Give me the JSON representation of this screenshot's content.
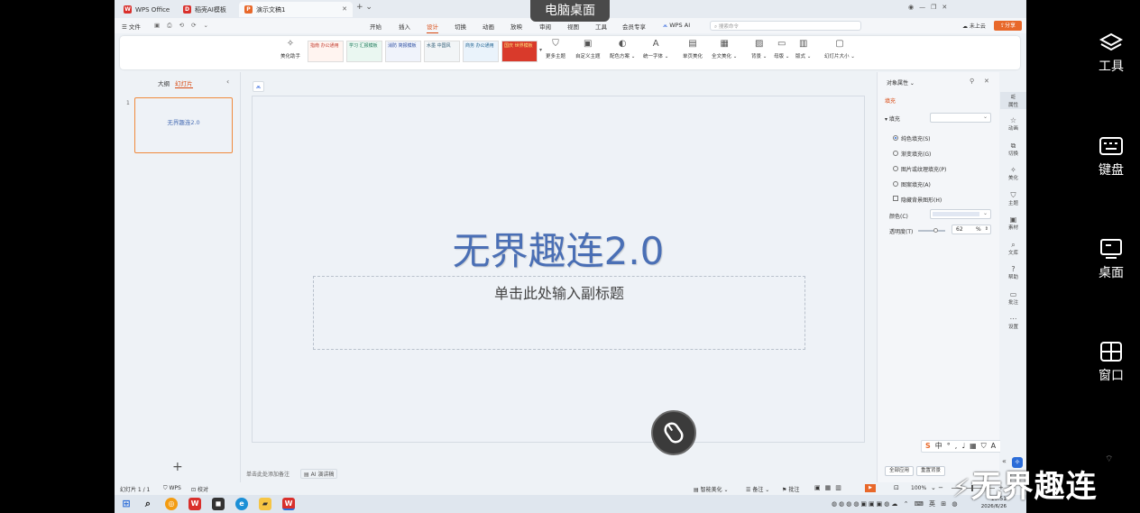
{
  "overlay": {
    "label": "电脑桌面",
    "watermark": "无界趣连"
  },
  "side_panel": [
    {
      "label": "工具",
      "icon": "layers-icon"
    },
    {
      "label": "键盘",
      "icon": "keyboard-icon"
    },
    {
      "label": "桌面",
      "icon": "monitor-icon"
    },
    {
      "label": "窗口",
      "icon": "window-grid-icon"
    }
  ],
  "tabs": [
    {
      "label": "WPS Office"
    },
    {
      "label": "稻壳AI模板"
    },
    {
      "label": "演示文稿1"
    }
  ],
  "menu": {
    "file": "文件",
    "items": [
      "开始",
      "插入",
      "设计",
      "切换",
      "动画",
      "放映",
      "审阅",
      "视图",
      "工具",
      "会员专享"
    ],
    "active": "设计",
    "wps_ai": "WPS AI",
    "search_placeholder": "搜索命令",
    "cloud": "未上云",
    "share": "分享"
  },
  "ribbon": {
    "beautify": "美化助手",
    "themes": [
      {
        "text": "指南 办公通用"
      },
      {
        "text": "学习 汇报模板"
      },
      {
        "text": "消防 简报模板"
      },
      {
        "text": "水墨 中国风"
      },
      {
        "text": "商务 办公通用"
      },
      {
        "text": "国庆 世界模板"
      }
    ],
    "more_themes": "更多主题",
    "custom_theme": "自定义主题",
    "color_scheme": "配色方案",
    "unify_font": "统一字体",
    "single_beautify": "单页美化",
    "full_beautify": "全文美化",
    "background": "背景",
    "master": "母版",
    "layout": "版式",
    "slide_size": "幻灯片大小"
  },
  "left_panel": {
    "tab_outline": "大纲",
    "tab_slides": "幻灯片",
    "slide_number": "1",
    "thumb_title": "无界趣连2.0",
    "add": "+"
  },
  "slide": {
    "title": "无界趣连2.0",
    "subtitle_placeholder": "单击此处输入副标题"
  },
  "notes": {
    "placeholder": "单击此处添加备注",
    "ai_speech": "AI 演讲稿"
  },
  "properties": {
    "header": "对象属性",
    "tab_fill": "填充",
    "fill_label": "填充",
    "options": [
      "纯色填充(S)",
      "渐变填充(G)",
      "图片或纹理填充(P)",
      "图案填充(A)"
    ],
    "selected_option": "纯色填充(S)",
    "hide_bg": "隐藏背景图形(H)",
    "color_label": "颜色(C)",
    "transparency_label": "透明度(T)",
    "transparency_value": "62",
    "transparency_unit": "%",
    "apply_all": "全部应用",
    "reset_bg": "重置背景"
  },
  "right_toolbar": [
    "属性",
    "动画",
    "切换",
    "美化",
    "主题",
    "素材",
    "文库",
    "帮助",
    "批注",
    "设置"
  ],
  "status": {
    "slide_count": "幻灯片 1 / 1",
    "wps": "WPS",
    "proofread": "校对",
    "smart_beautify": "智能美化",
    "notes": "备注",
    "comment": "批注",
    "zoom": "100%"
  },
  "clock": {
    "time": "10:51",
    "date": "2026/6/26"
  },
  "colors": {
    "accent": "#d9480f",
    "title_blue": "#4a6fb5",
    "selection_orange": "#f08a3c"
  }
}
